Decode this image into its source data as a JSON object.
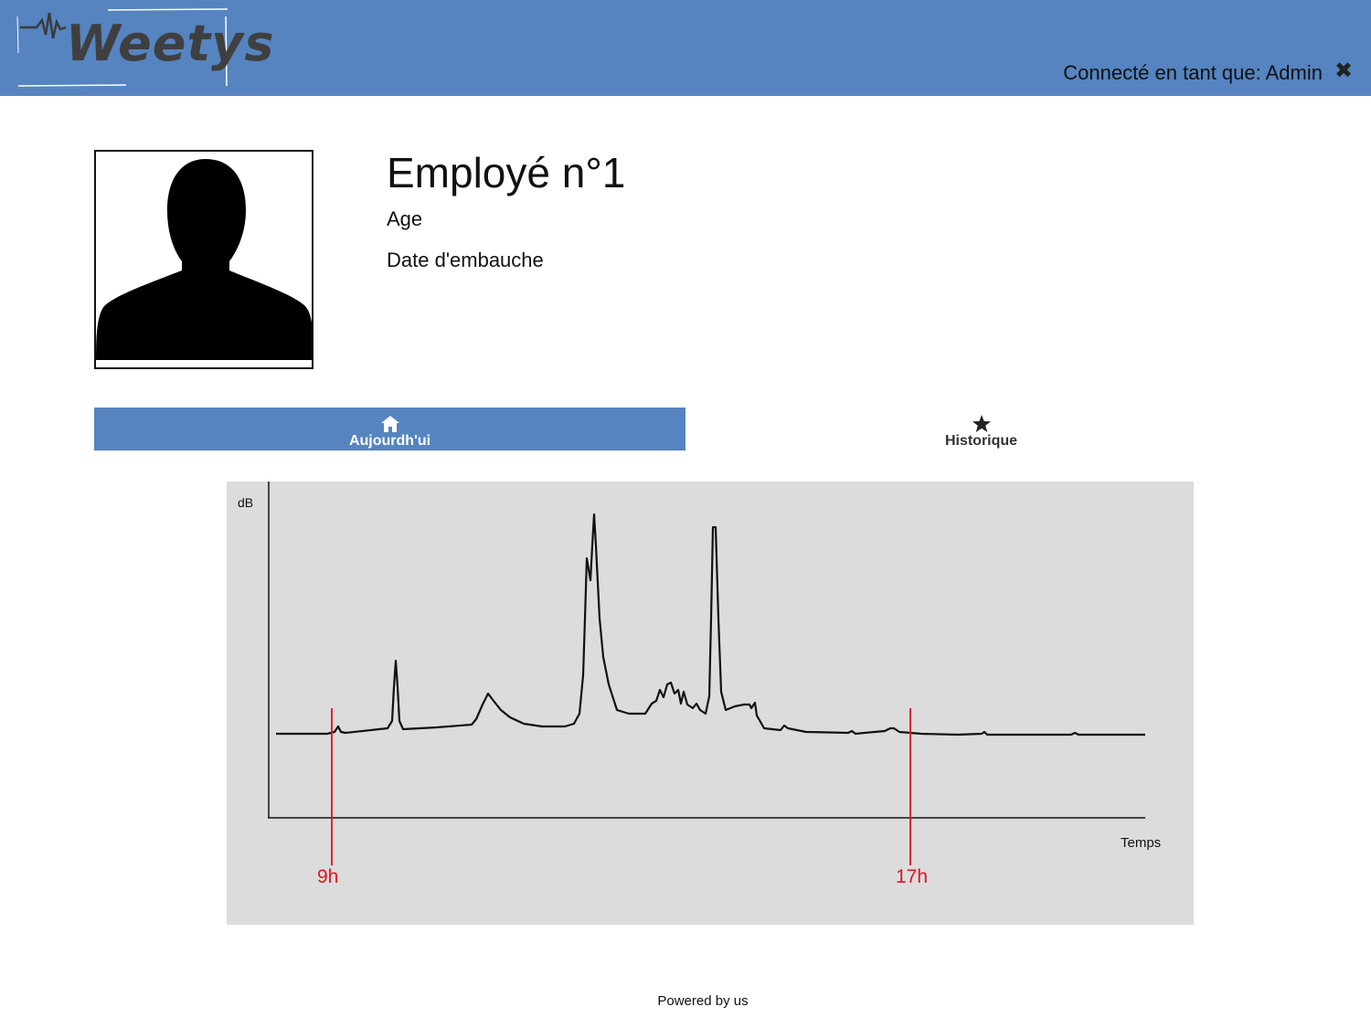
{
  "header": {
    "logo_text": "Weetys",
    "user_label": "Connecté en tant que: Admin",
    "close_icon": "close-icon",
    "background": "#5584c0"
  },
  "employee": {
    "name": "Employé n°1",
    "age_label": "Age",
    "hire_date_label": "Date d'embauche",
    "avatar_icon": "user-silhouette-icon"
  },
  "tabs": [
    {
      "label": "Aujourdh'ui",
      "icon": "home-icon",
      "active": true
    },
    {
      "label": "Historique",
      "icon": "star-icon",
      "active": false
    }
  ],
  "chart_data": {
    "type": "line",
    "ylabel": "dB",
    "xlabel": "Temps",
    "markers": [
      {
        "label": "9h",
        "color": "#e0141e"
      },
      {
        "label": "17h",
        "color": "#e0141e"
      }
    ],
    "grid": false,
    "line_color": "#111111",
    "background": "#dcdcdc"
  },
  "footer": {
    "text": "Powered by us"
  }
}
